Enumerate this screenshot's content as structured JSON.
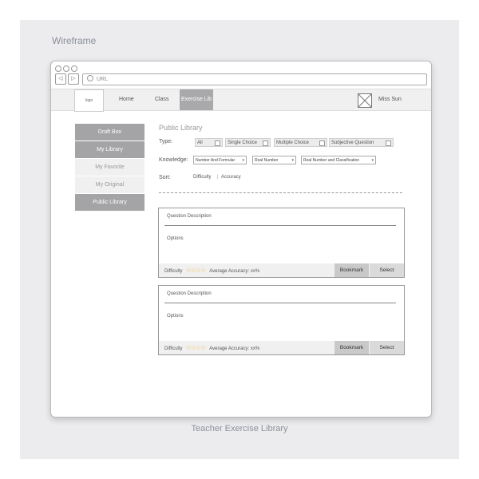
{
  "wireframe_label": "Wireframe",
  "caption": "Teacher Exercise Library",
  "browser": {
    "nav_back": "◁",
    "nav_forward": "▷",
    "url_placeholder": "URL"
  },
  "topbar": {
    "logo": "logo",
    "nav": [
      "Home",
      "Class",
      "Exercise Lib"
    ],
    "user": "Miss Sun"
  },
  "sidebar": [
    {
      "label": "Draft Box",
      "style": "dark"
    },
    {
      "label": "My Library",
      "style": "dark"
    },
    {
      "label": "My Favorite",
      "style": "light"
    },
    {
      "label": "My Original",
      "style": "light"
    },
    {
      "label": "Public Library",
      "style": "dark"
    }
  ],
  "main": {
    "title": "Public Library",
    "type_label": "Type:",
    "types": [
      "All",
      "Single Choice",
      "Multiple Choice",
      "Subjective Question"
    ],
    "knowledge_label": "Knowledge:",
    "knowledge": [
      "Number And Formular",
      "Real Number",
      "Real Number and Classification"
    ],
    "dropdown_arrow": "▾",
    "sort_label": "Sort:",
    "sort_options": [
      "Difficulty",
      "Accuracy"
    ],
    "sort_separator": "|"
  },
  "questions": [
    {
      "description": "Question Description",
      "options": "Options",
      "difficulty_label": "Difficulty",
      "stars": "☆☆☆☆",
      "accuracy": "Average Accuracy: xx%",
      "bookmark": "Bookmark",
      "select": "Select"
    },
    {
      "description": "Question Description",
      "options": "Options",
      "difficulty_label": "Difficulty",
      "stars": "☆☆☆☆",
      "accuracy": "Average Accuracy: xx%",
      "bookmark": "Bookmark",
      "select": "Select"
    }
  ]
}
